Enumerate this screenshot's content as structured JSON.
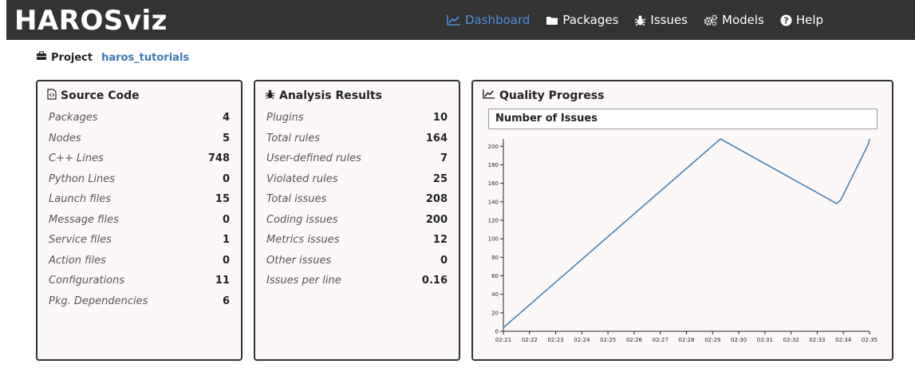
{
  "app": {
    "brand": "HAROSviz"
  },
  "nav": [
    {
      "label": "Dashboard",
      "icon": "line-chart-icon",
      "active": true
    },
    {
      "label": "Packages",
      "icon": "folder-icon",
      "active": false
    },
    {
      "label": "Issues",
      "icon": "bug-icon",
      "active": false
    },
    {
      "label": "Models",
      "icon": "gears-icon",
      "active": false
    },
    {
      "label": "Help",
      "icon": "question-circle-icon",
      "active": false
    }
  ],
  "project": {
    "label": "Project",
    "name": "haros_tutorials"
  },
  "source_code": {
    "title": "Source Code",
    "rows": [
      {
        "label": "Packages",
        "value": "4"
      },
      {
        "label": "Nodes",
        "value": "5"
      },
      {
        "label": "C++ Lines",
        "value": "748"
      },
      {
        "label": "Python Lines",
        "value": "0"
      },
      {
        "label": "Launch files",
        "value": "15"
      },
      {
        "label": "Message files",
        "value": "0"
      },
      {
        "label": "Service files",
        "value": "1"
      },
      {
        "label": "Action files",
        "value": "0"
      },
      {
        "label": "Configurations",
        "value": "11"
      },
      {
        "label": "Pkg. Dependencies",
        "value": "6"
      }
    ]
  },
  "analysis": {
    "title": "Analysis Results",
    "rows": [
      {
        "label": "Plugins",
        "value": "10"
      },
      {
        "label": "Total rules",
        "value": "164"
      },
      {
        "label": "User-defined rules",
        "value": "7"
      },
      {
        "label": "Violated rules",
        "value": "25"
      },
      {
        "label": "Total issues",
        "value": "208"
      },
      {
        "label": "Coding issues",
        "value": "200"
      },
      {
        "label": "Metrics issues",
        "value": "12"
      },
      {
        "label": "Other issues",
        "value": "0"
      },
      {
        "label": "Issues per line",
        "value": "0.16"
      }
    ]
  },
  "quality": {
    "title": "Quality Progress",
    "chart_header": "Number of Issues"
  },
  "colors": {
    "navbar": "#333333",
    "accent": "#4a90d9",
    "line": "#4682b4",
    "panel_bg": "#fdf8f8"
  },
  "chart_data": {
    "type": "line",
    "title": "Number of Issues",
    "x_ticks": [
      "02:21",
      "02:22",
      "02:23",
      "02:24",
      "02:25",
      "02:26",
      "02:27",
      "02:28",
      "02:29",
      "02:30",
      "02:31",
      "02:32",
      "02:33",
      "02:34",
      "02:35"
    ],
    "y_ticks": [
      0,
      20,
      40,
      60,
      80,
      100,
      120,
      140,
      160,
      180,
      200
    ],
    "ylim": [
      0,
      208
    ],
    "xlim_minutes": [
      0,
      14
    ],
    "series": [
      {
        "points": [
          [
            0,
            4
          ],
          [
            8.3,
            208
          ],
          [
            12.75,
            138
          ],
          [
            12.9,
            142
          ],
          [
            13.95,
            202
          ],
          [
            14,
            208
          ]
        ]
      }
    ],
    "grid": false
  }
}
